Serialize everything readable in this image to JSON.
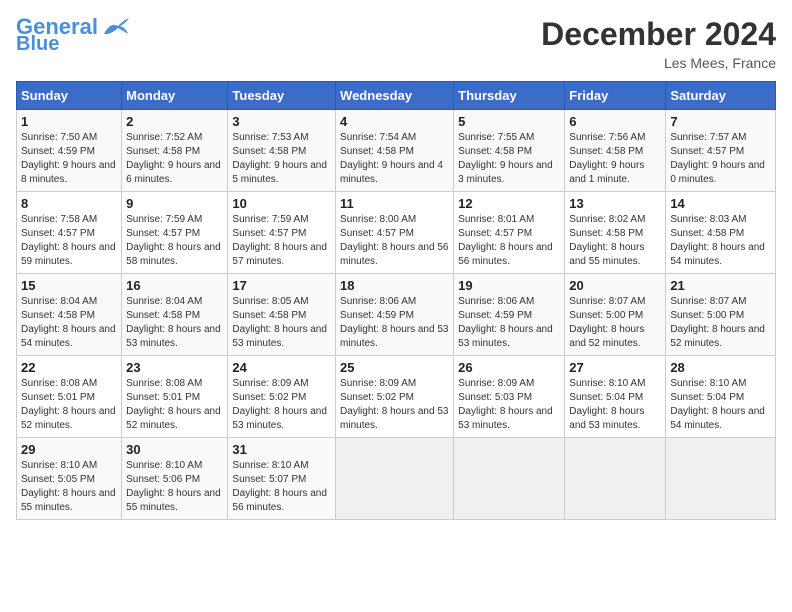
{
  "header": {
    "logo_line1": "General",
    "logo_line2": "Blue",
    "month": "December 2024",
    "location": "Les Mees, France"
  },
  "days_of_week": [
    "Sunday",
    "Monday",
    "Tuesday",
    "Wednesday",
    "Thursday",
    "Friday",
    "Saturday"
  ],
  "weeks": [
    [
      {
        "day": "1",
        "info": "Sunrise: 7:50 AM\nSunset: 4:59 PM\nDaylight: 9 hours and 8 minutes."
      },
      {
        "day": "2",
        "info": "Sunrise: 7:52 AM\nSunset: 4:58 PM\nDaylight: 9 hours and 6 minutes."
      },
      {
        "day": "3",
        "info": "Sunrise: 7:53 AM\nSunset: 4:58 PM\nDaylight: 9 hours and 5 minutes."
      },
      {
        "day": "4",
        "info": "Sunrise: 7:54 AM\nSunset: 4:58 PM\nDaylight: 9 hours and 4 minutes."
      },
      {
        "day": "5",
        "info": "Sunrise: 7:55 AM\nSunset: 4:58 PM\nDaylight: 9 hours and 3 minutes."
      },
      {
        "day": "6",
        "info": "Sunrise: 7:56 AM\nSunset: 4:58 PM\nDaylight: 9 hours and 1 minute."
      },
      {
        "day": "7",
        "info": "Sunrise: 7:57 AM\nSunset: 4:57 PM\nDaylight: 9 hours and 0 minutes."
      }
    ],
    [
      {
        "day": "8",
        "info": "Sunrise: 7:58 AM\nSunset: 4:57 PM\nDaylight: 8 hours and 59 minutes."
      },
      {
        "day": "9",
        "info": "Sunrise: 7:59 AM\nSunset: 4:57 PM\nDaylight: 8 hours and 58 minutes."
      },
      {
        "day": "10",
        "info": "Sunrise: 7:59 AM\nSunset: 4:57 PM\nDaylight: 8 hours and 57 minutes."
      },
      {
        "day": "11",
        "info": "Sunrise: 8:00 AM\nSunset: 4:57 PM\nDaylight: 8 hours and 56 minutes."
      },
      {
        "day": "12",
        "info": "Sunrise: 8:01 AM\nSunset: 4:57 PM\nDaylight: 8 hours and 56 minutes."
      },
      {
        "day": "13",
        "info": "Sunrise: 8:02 AM\nSunset: 4:58 PM\nDaylight: 8 hours and 55 minutes."
      },
      {
        "day": "14",
        "info": "Sunrise: 8:03 AM\nSunset: 4:58 PM\nDaylight: 8 hours and 54 minutes."
      }
    ],
    [
      {
        "day": "15",
        "info": "Sunrise: 8:04 AM\nSunset: 4:58 PM\nDaylight: 8 hours and 54 minutes."
      },
      {
        "day": "16",
        "info": "Sunrise: 8:04 AM\nSunset: 4:58 PM\nDaylight: 8 hours and 53 minutes."
      },
      {
        "day": "17",
        "info": "Sunrise: 8:05 AM\nSunset: 4:58 PM\nDaylight: 8 hours and 53 minutes."
      },
      {
        "day": "18",
        "info": "Sunrise: 8:06 AM\nSunset: 4:59 PM\nDaylight: 8 hours and 53 minutes."
      },
      {
        "day": "19",
        "info": "Sunrise: 8:06 AM\nSunset: 4:59 PM\nDaylight: 8 hours and 53 minutes."
      },
      {
        "day": "20",
        "info": "Sunrise: 8:07 AM\nSunset: 5:00 PM\nDaylight: 8 hours and 52 minutes."
      },
      {
        "day": "21",
        "info": "Sunrise: 8:07 AM\nSunset: 5:00 PM\nDaylight: 8 hours and 52 minutes."
      }
    ],
    [
      {
        "day": "22",
        "info": "Sunrise: 8:08 AM\nSunset: 5:01 PM\nDaylight: 8 hours and 52 minutes."
      },
      {
        "day": "23",
        "info": "Sunrise: 8:08 AM\nSunset: 5:01 PM\nDaylight: 8 hours and 52 minutes."
      },
      {
        "day": "24",
        "info": "Sunrise: 8:09 AM\nSunset: 5:02 PM\nDaylight: 8 hours and 53 minutes."
      },
      {
        "day": "25",
        "info": "Sunrise: 8:09 AM\nSunset: 5:02 PM\nDaylight: 8 hours and 53 minutes."
      },
      {
        "day": "26",
        "info": "Sunrise: 8:09 AM\nSunset: 5:03 PM\nDaylight: 8 hours and 53 minutes."
      },
      {
        "day": "27",
        "info": "Sunrise: 8:10 AM\nSunset: 5:04 PM\nDaylight: 8 hours and 53 minutes."
      },
      {
        "day": "28",
        "info": "Sunrise: 8:10 AM\nSunset: 5:04 PM\nDaylight: 8 hours and 54 minutes."
      }
    ],
    [
      {
        "day": "29",
        "info": "Sunrise: 8:10 AM\nSunset: 5:05 PM\nDaylight: 8 hours and 55 minutes."
      },
      {
        "day": "30",
        "info": "Sunrise: 8:10 AM\nSunset: 5:06 PM\nDaylight: 8 hours and 55 minutes."
      },
      {
        "day": "31",
        "info": "Sunrise: 8:10 AM\nSunset: 5:07 PM\nDaylight: 8 hours and 56 minutes."
      },
      null,
      null,
      null,
      null
    ]
  ]
}
